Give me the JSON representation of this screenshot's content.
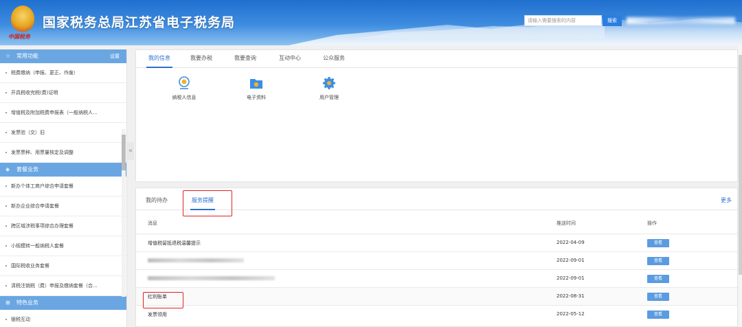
{
  "header": {
    "emblem_text": "中国税务",
    "title": "国家税务总局江苏省电子税务局",
    "search_placeholder": "请输入需要搜索的内容",
    "search_button": "搜索"
  },
  "sidebar": {
    "common": {
      "title": "常用功能",
      "action": "设置",
      "items": [
        "税费缴纳（申报、更正、作废）",
        "开具税收完税(费)证明",
        "增值税及附加税费申报表（一般纳税人...",
        "发票验（交）旧",
        "发票票种、用票量核定及调整"
      ]
    },
    "packages": {
      "title": "套餐业务",
      "items": [
        "新办个体工商户综合申请套餐",
        "新办企业综合申请套餐",
        "跨区域涉税事项综合办理套餐",
        "小规模转一般纳税人套餐",
        "国际税收业务套餐",
        "清税注销税（费）申报及缴纳套餐（合..."
      ]
    },
    "special": {
      "title": "特色业务",
      "items": [
        "银税互动"
      ]
    },
    "collapse_glyph": "«"
  },
  "panel1": {
    "tabs": [
      "我的信息",
      "我要办税",
      "我要查询",
      "互动中心",
      "公众服务"
    ],
    "apps": [
      {
        "label": "纳税人信息",
        "icon": "taxpayer-info-icon"
      },
      {
        "label": "电子资料",
        "icon": "e-documents-icon"
      },
      {
        "label": "用户管理",
        "icon": "user-management-icon"
      }
    ]
  },
  "panel2": {
    "tabs": [
      "我的待办",
      "服务提醒"
    ],
    "more": "更多",
    "columns": [
      "消息",
      "推送时间",
      "操作"
    ],
    "rows": [
      {
        "message": "增值税留抵退税温馨提示",
        "date": "2022-04-09",
        "action": "查看",
        "blurred": false
      },
      {
        "message": "",
        "date": "2022-09-01",
        "action": "查看",
        "blurred": true
      },
      {
        "message": "",
        "date": "2022-09-01",
        "action": "查看",
        "blurred": true
      },
      {
        "message": "红利账单",
        "date": "2022-08-31",
        "action": "查看",
        "blurred": false
      },
      {
        "message": "发票领用",
        "date": "2022-05-12",
        "action": "查看",
        "blurred": false
      }
    ]
  },
  "colors": {
    "accent": "#2b6fd0",
    "sidebar_header": "#6aa6e2",
    "view_button": "#5b9be0",
    "highlight": "#e02020"
  }
}
